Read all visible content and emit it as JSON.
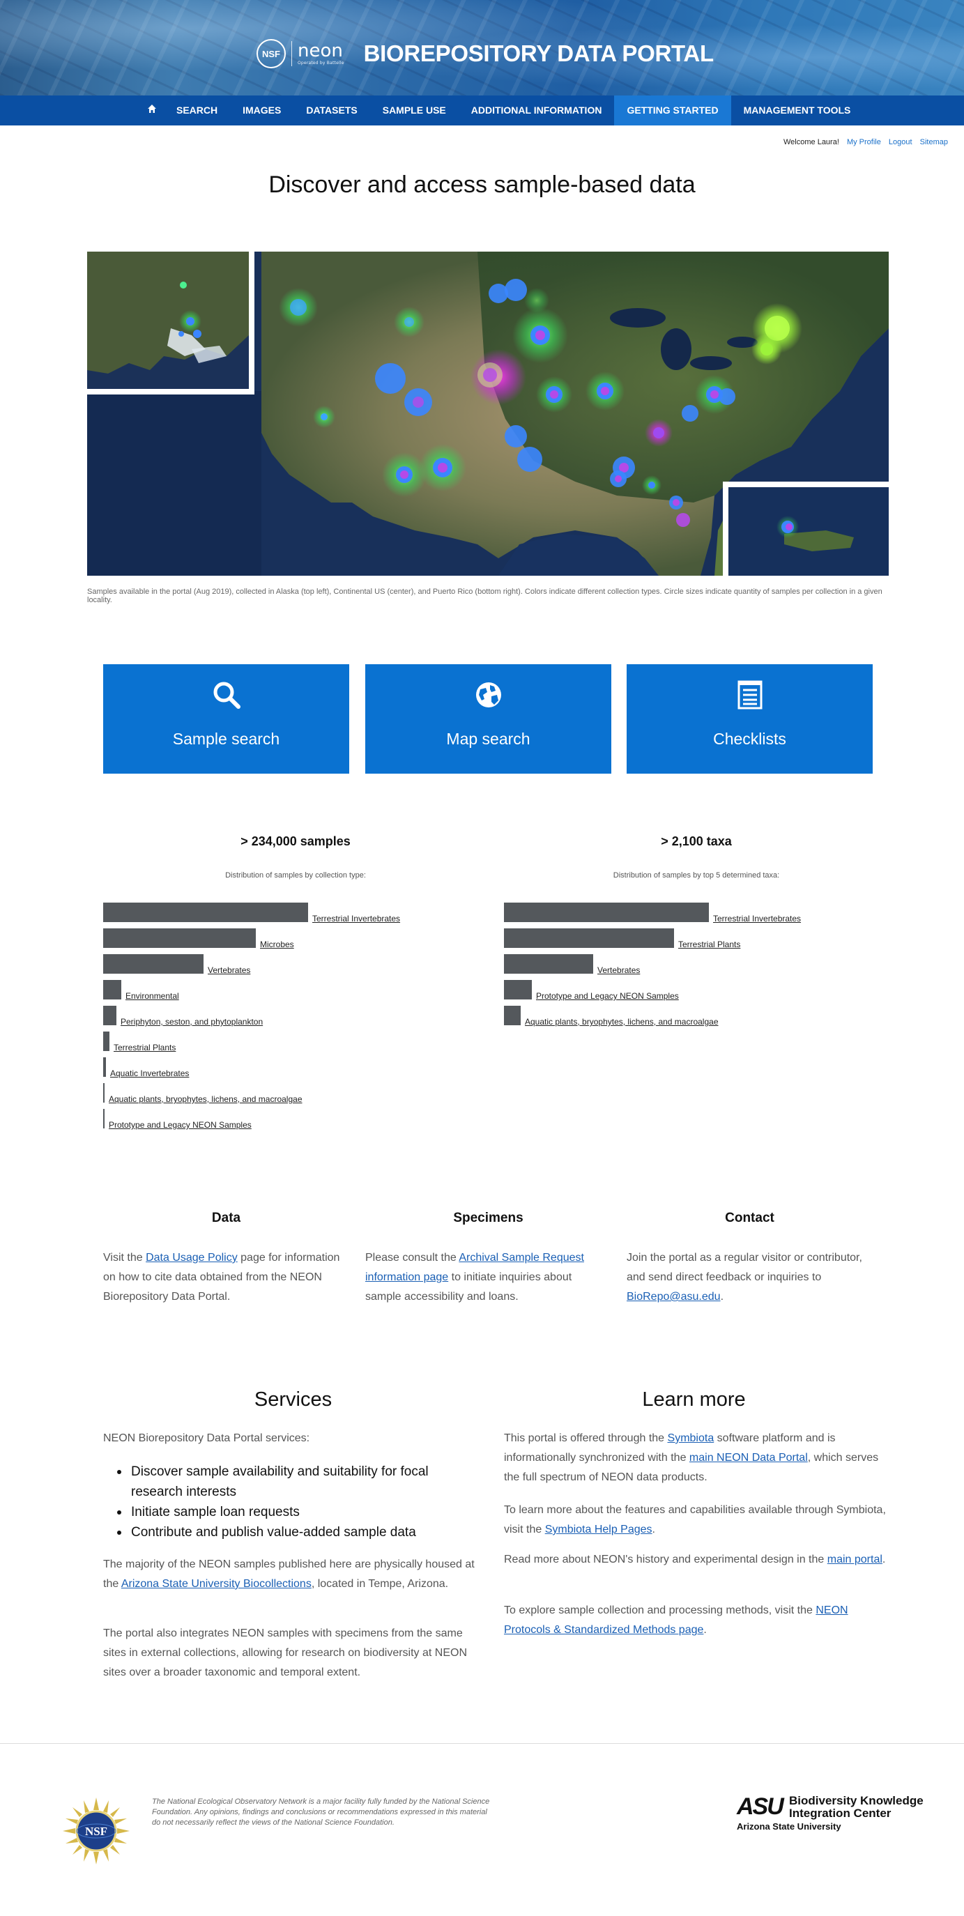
{
  "header": {
    "nsf_badge": "NSF",
    "neon_word": "neon",
    "neon_sub": "Operated by Battelle",
    "title": "BIOREPOSITORY DATA PORTAL"
  },
  "nav": {
    "home_icon": "home-icon",
    "items": [
      "SEARCH",
      "IMAGES",
      "DATASETS",
      "SAMPLE USE",
      "ADDITIONAL INFORMATION",
      "GETTING STARTED",
      "MANAGEMENT TOOLS"
    ],
    "active": "GETTING STARTED"
  },
  "userbar": {
    "welcome": "Welcome Laura!",
    "my_profile": "My Profile",
    "logout": "Logout",
    "sitemap": "Sitemap"
  },
  "page_title": "Discover and access sample-based data",
  "map": {
    "caption": "Samples available in the portal (Aug 2019), collected in Alaska (top left), Continental US (center), and Puerto Rico (bottom right). Colors indicate different collection types. Circle sizes indicate quantity of samples per collection in a given locality."
  },
  "tiles": [
    {
      "label": "Sample search",
      "icon": "search-icon"
    },
    {
      "label": "Map search",
      "icon": "globe-icon"
    },
    {
      "label": "Checklists",
      "icon": "checklist-icon"
    }
  ],
  "stats": {
    "samples": {
      "heading": "> 234,000 samples",
      "subtitle": "Distribution of samples by collection type:",
      "bars": [
        {
          "label": "Terrestrial Invertebrates",
          "value": 1.0
        },
        {
          "label": "Microbes",
          "value": 0.745
        },
        {
          "label": "Vertebrates",
          "value": 0.49
        },
        {
          "label": "Environmental",
          "value": 0.09
        },
        {
          "label": "Periphyton, seston, and phytoplankton",
          "value": 0.065
        },
        {
          "label": "Terrestrial Plants",
          "value": 0.03
        },
        {
          "label": "Aquatic Invertebrates",
          "value": 0.012
        },
        {
          "label": "Aquatic plants, bryophytes, lichens, and macroalgae",
          "value": 0.006
        },
        {
          "label": "Prototype and Legacy NEON Samples",
          "value": 0.004
        }
      ]
    },
    "taxa": {
      "heading": "> 2,100 taxa",
      "subtitle": "Distribution of samples by top 5 determined taxa:",
      "bars": [
        {
          "label": "Terrestrial Invertebrates",
          "value": 1.0
        },
        {
          "label": "Terrestrial Plants",
          "value": 0.83
        },
        {
          "label": "Vertebrates",
          "value": 0.435
        },
        {
          "label": "Prototype and Legacy NEON Samples",
          "value": 0.135
        },
        {
          "label": "Aquatic plants, bryophytes, lichens, and macroalgae",
          "value": 0.08
        }
      ]
    }
  },
  "info": {
    "data": {
      "heading": "Data",
      "pre": "Visit the ",
      "link": "Data Usage Policy",
      "post": " page for information on how to cite data obtained from the NEON Biorepository Data Portal."
    },
    "specimens": {
      "heading": "Specimens",
      "pre": "Please consult the ",
      "link": "Archival Sample Request information page",
      "post": " to initiate inquiries about sample accessibility and loans."
    },
    "contact": {
      "heading": "Contact",
      "pre": "Join the portal as a regular visitor or contributor, and send direct feedback or inquiries to ",
      "link": "BioRepo@asu.edu",
      "post": "."
    }
  },
  "services": {
    "heading": "Services",
    "intro": "NEON Biorepository Data Portal services:",
    "bullets": [
      "Discover sample availability and suitability for focal research interests",
      "Initiate sample loan requests",
      "Contribute and publish value-added sample data"
    ],
    "p2_pre": "The majority of the NEON samples published here are physically housed at the ",
    "p2_link": "Arizona State University Biocollections",
    "p2_post": ", located in Tempe, Arizona.",
    "p3": "The portal also integrates NEON samples with specimens from the same sites in external collections, allowing for research on biodiversity at NEON sites over a broader taxonomic and temporal extent."
  },
  "learn": {
    "heading": "Learn more",
    "p1_pre": "This portal is offered through the ",
    "p1_link1": "Symbiota",
    "p1_mid": " software platform and is informationally synchronized with the ",
    "p1_link2": "main NEON Data Portal",
    "p1_post": ", which serves the full spectrum of NEON data products.",
    "p2_pre": "To learn more about the features and capabilities available through Symbiota, visit the ",
    "p2_link": "Symbiota Help Pages",
    "p2_post": ".",
    "p3_pre": "Read more about NEON's history and experimental design in the ",
    "p3_link": "main portal",
    "p3_post": ".",
    "p4_pre": "To explore sample collection and processing methods, visit the ",
    "p4_link": "NEON Protocols & Standardized Methods page",
    "p4_post": "."
  },
  "footer": {
    "nsf_logo_text": "NSF",
    "disclaimer": "The National Ecological Observatory Network is a major facility fully funded by the National Science Foundation. Any opinions, findings and conclusions or recommendations expressed in this material do not necessarily reflect the views of the National Science Foundation.",
    "asu_mark": "ASU",
    "bkic_line1": "Biodiversity Knowledge",
    "bkic_line2": "Integration Center",
    "university": "Arizona State University"
  }
}
